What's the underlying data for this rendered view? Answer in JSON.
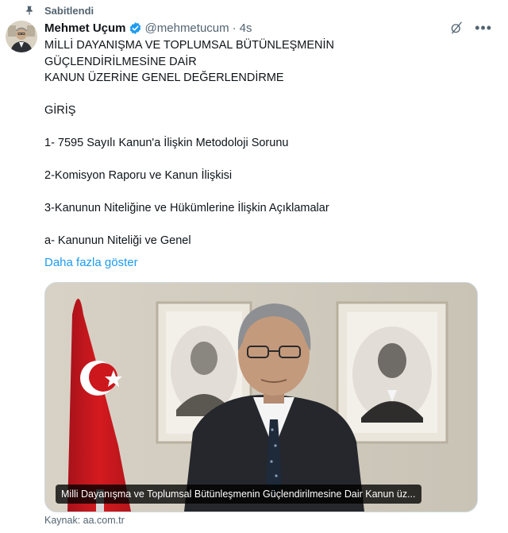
{
  "pinned": {
    "label": "Sabitlendi"
  },
  "author": {
    "name": "Mehmet Uçum",
    "handle": "@mehmetucum",
    "separator": "·",
    "time": "4s"
  },
  "tweet": {
    "lines": [
      "MİLLİ DAYANIŞMA VE TOPLUMSAL BÜTÜNLEŞMENİN",
      "GÜÇLENDİRİLMESİNE DAİR",
      "KANUN ÜZERİNE GENEL DEĞERLENDİRME",
      "",
      "GİRİŞ",
      "",
      "1- 7595 Sayılı Kanun'a İlişkin Metodoloji Sorunu",
      "",
      "2-Komisyon Raporu ve Kanun İlişkisi",
      "",
      "3-Kanunun Niteliğine ve Hükümlerine İlişkin Açıklamalar",
      "",
      "a- Kanunun Niteliği ve Genel"
    ],
    "show_more": "Daha fazla göster"
  },
  "media": {
    "caption": "Milli Dayanışma ve Toplumsal Bütünleşmenin Güçlendirilmesine Dair Kanun üz..."
  },
  "link_card": {
    "source_label": "Kaynak:",
    "source_domain": "aa.com.tr"
  },
  "icons": {
    "pin": "pin-icon",
    "verified": "verified-badge-icon",
    "grok": "grok-icon",
    "more": "more-icon"
  },
  "colors": {
    "link": "#1d9bf0",
    "secondary_text": "#536471",
    "primary_text": "#0f1419",
    "flag_red": "#d41a1f"
  }
}
